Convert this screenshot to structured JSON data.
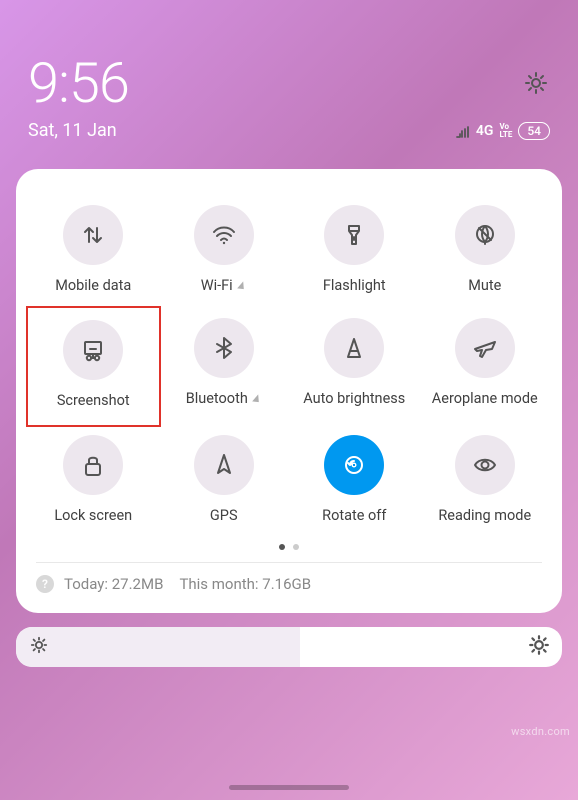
{
  "status": {
    "time": "9:56",
    "date": "Sat, 11 Jan",
    "network_type": "4G",
    "volte": "Vo\nLTE",
    "battery_percent": "54"
  },
  "quick_settings": {
    "tiles": [
      {
        "label": "Mobile data",
        "icon": "mobile-data-icon",
        "active": false,
        "expandable": false,
        "highlighted": false
      },
      {
        "label": "Wi-Fi",
        "icon": "wifi-icon",
        "active": false,
        "expandable": true,
        "highlighted": false
      },
      {
        "label": "Flashlight",
        "icon": "flashlight-icon",
        "active": false,
        "expandable": false,
        "highlighted": false
      },
      {
        "label": "Mute",
        "icon": "mute-icon",
        "active": false,
        "expandable": false,
        "highlighted": false
      },
      {
        "label": "Screenshot",
        "icon": "screenshot-icon",
        "active": false,
        "expandable": false,
        "highlighted": true
      },
      {
        "label": "Bluetooth",
        "icon": "bluetooth-icon",
        "active": false,
        "expandable": true,
        "highlighted": false
      },
      {
        "label": "Auto brightness",
        "icon": "auto-brightness-icon",
        "active": false,
        "expandable": false,
        "highlighted": false
      },
      {
        "label": "Aeroplane mode",
        "icon": "aeroplane-mode-icon",
        "active": false,
        "expandable": false,
        "highlighted": false
      },
      {
        "label": "Lock screen",
        "icon": "lock-screen-icon",
        "active": false,
        "expandable": false,
        "highlighted": false
      },
      {
        "label": "GPS",
        "icon": "gps-icon",
        "active": false,
        "expandable": false,
        "highlighted": false
      },
      {
        "label": "Rotate off",
        "icon": "rotate-off-icon",
        "active": true,
        "expandable": false,
        "highlighted": false
      },
      {
        "label": "Reading mode",
        "icon": "reading-mode-icon",
        "active": false,
        "expandable": false,
        "highlighted": false
      }
    ],
    "page_count": 2,
    "active_page": 0,
    "data_usage": {
      "today_label": "Today: 27.2MB",
      "month_label": "This month: 7.16GB"
    }
  },
  "brightness": {
    "level_fraction": 0.52
  },
  "watermark": "wsxdn.com"
}
